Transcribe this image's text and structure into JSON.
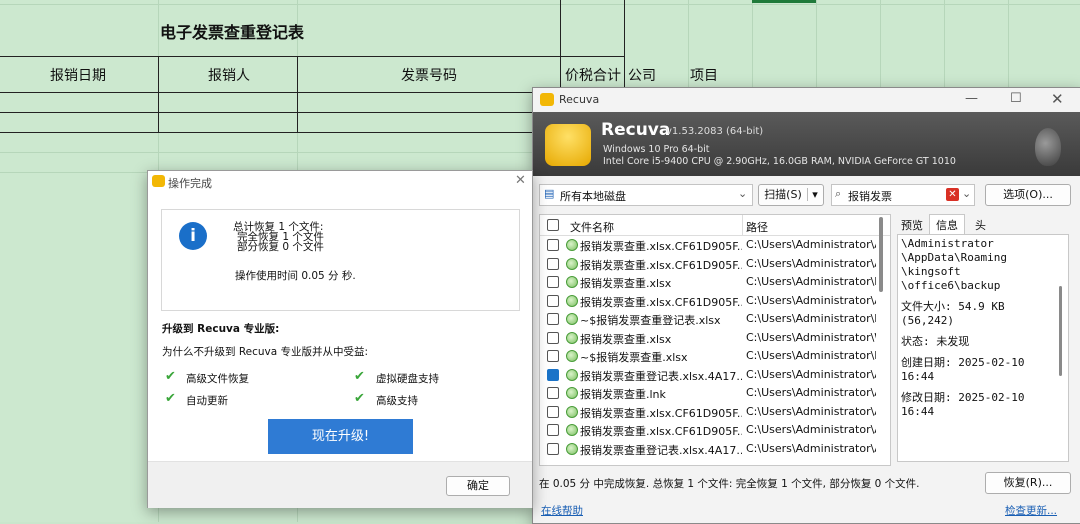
{
  "sheet": {
    "title": "电子发票查重登记表",
    "headers": [
      "报销日期",
      "报销人",
      "发票号码",
      "价税合计",
      "公司",
      "项目"
    ]
  },
  "recuva": {
    "window_title": "Recuva",
    "app_name": "Recuva",
    "version": "v1.53.2083 (64-bit)",
    "os": "Windows 10 Pro 64-bit",
    "hardware": "Intel Core i5-9400 CPU @ 2.90GHz, 16.0GB RAM, NVIDIA GeForce GT 1010",
    "drive_select": "所有本地磁盘",
    "scan_label": "扫描(S)",
    "search_value": "报销发票",
    "options_label": "选项(O)...",
    "col_filename": "文件名称",
    "col_path": "路径",
    "files": [
      {
        "name": "报销发票查重.xlsx.CF61D905F...",
        "path": "C:\\Users\\Administrator\\A",
        "checked": false
      },
      {
        "name": "报销发票查重.xlsx.CF61D905F...",
        "path": "C:\\Users\\Administrator\\A",
        "checked": false
      },
      {
        "name": "报销发票查重.xlsx",
        "path": "C:\\Users\\Administrator\\D",
        "checked": false
      },
      {
        "name": "报销发票查重.xlsx.CF61D905F...",
        "path": "C:\\Users\\Administrator\\A",
        "checked": false
      },
      {
        "name": "~$报销发票查重登记表.xlsx",
        "path": "C:\\Users\\Administrator\\D",
        "checked": false
      },
      {
        "name": "报销发票查重.xlsx",
        "path": "C:\\Users\\Administrator\\W",
        "checked": false
      },
      {
        "name": "~$报销发票查重.xlsx",
        "path": "C:\\Users\\Administrator\\D",
        "checked": false
      },
      {
        "name": "报销发票查重登记表.xlsx.4A17...",
        "path": "C:\\Users\\Administrator\\A",
        "checked": true
      },
      {
        "name": "报销发票查重.lnk",
        "path": "C:\\Users\\Administrator\\A",
        "checked": false
      },
      {
        "name": "报销发票查重.xlsx.CF61D905F...",
        "path": "C:\\Users\\Administrator\\A",
        "checked": false
      },
      {
        "name": "报销发票查重.xlsx.CF61D905F...",
        "path": "C:\\Users\\Administrator\\A",
        "checked": false
      },
      {
        "name": "报销发票查重登记表.xlsx.4A17...",
        "path": "C:\\Users\\Administrator\\A",
        "checked": false
      }
    ],
    "tabs": [
      "预览",
      "信息",
      "头"
    ],
    "info_lines": [
      "\\Administrator",
      "\\AppData\\Roaming",
      "\\kingsoft",
      "\\office6\\backup",
      "",
      "文件大小: 54.9 KB",
      "(56,242)",
      "",
      "状态: 未发现",
      "",
      "创建日期: 2025-02-10",
      "16:44",
      "",
      "修改日期: 2025-02-10",
      "16:44"
    ],
    "status_text": "在 0.05 分 中完成恢复. 总恢复 1 个文件: 完全恢复 1 个文件, 部分恢复 0 个文件.",
    "recover_label": "恢复(R)...",
    "online_help": "在线帮助",
    "check_updates": "检查更新..."
  },
  "dialog": {
    "title": "操作完成",
    "total": "总计恢复 1 个文件:",
    "full": "完全恢复 1 个文件",
    "partial": "部分恢复 0 个文件",
    "time": "操作使用时间 0.05 分 秒.",
    "upgrade_heading": "升级到 Recuva 专业版:",
    "upgrade_question": "为什么不升级到 Recuva 专业版并从中受益:",
    "features": [
      "高级文件恢复",
      "虚拟硬盘支持",
      "自动更新",
      "高级支持"
    ],
    "upgrade_button": "现在升级!",
    "ok_button": "确定"
  }
}
